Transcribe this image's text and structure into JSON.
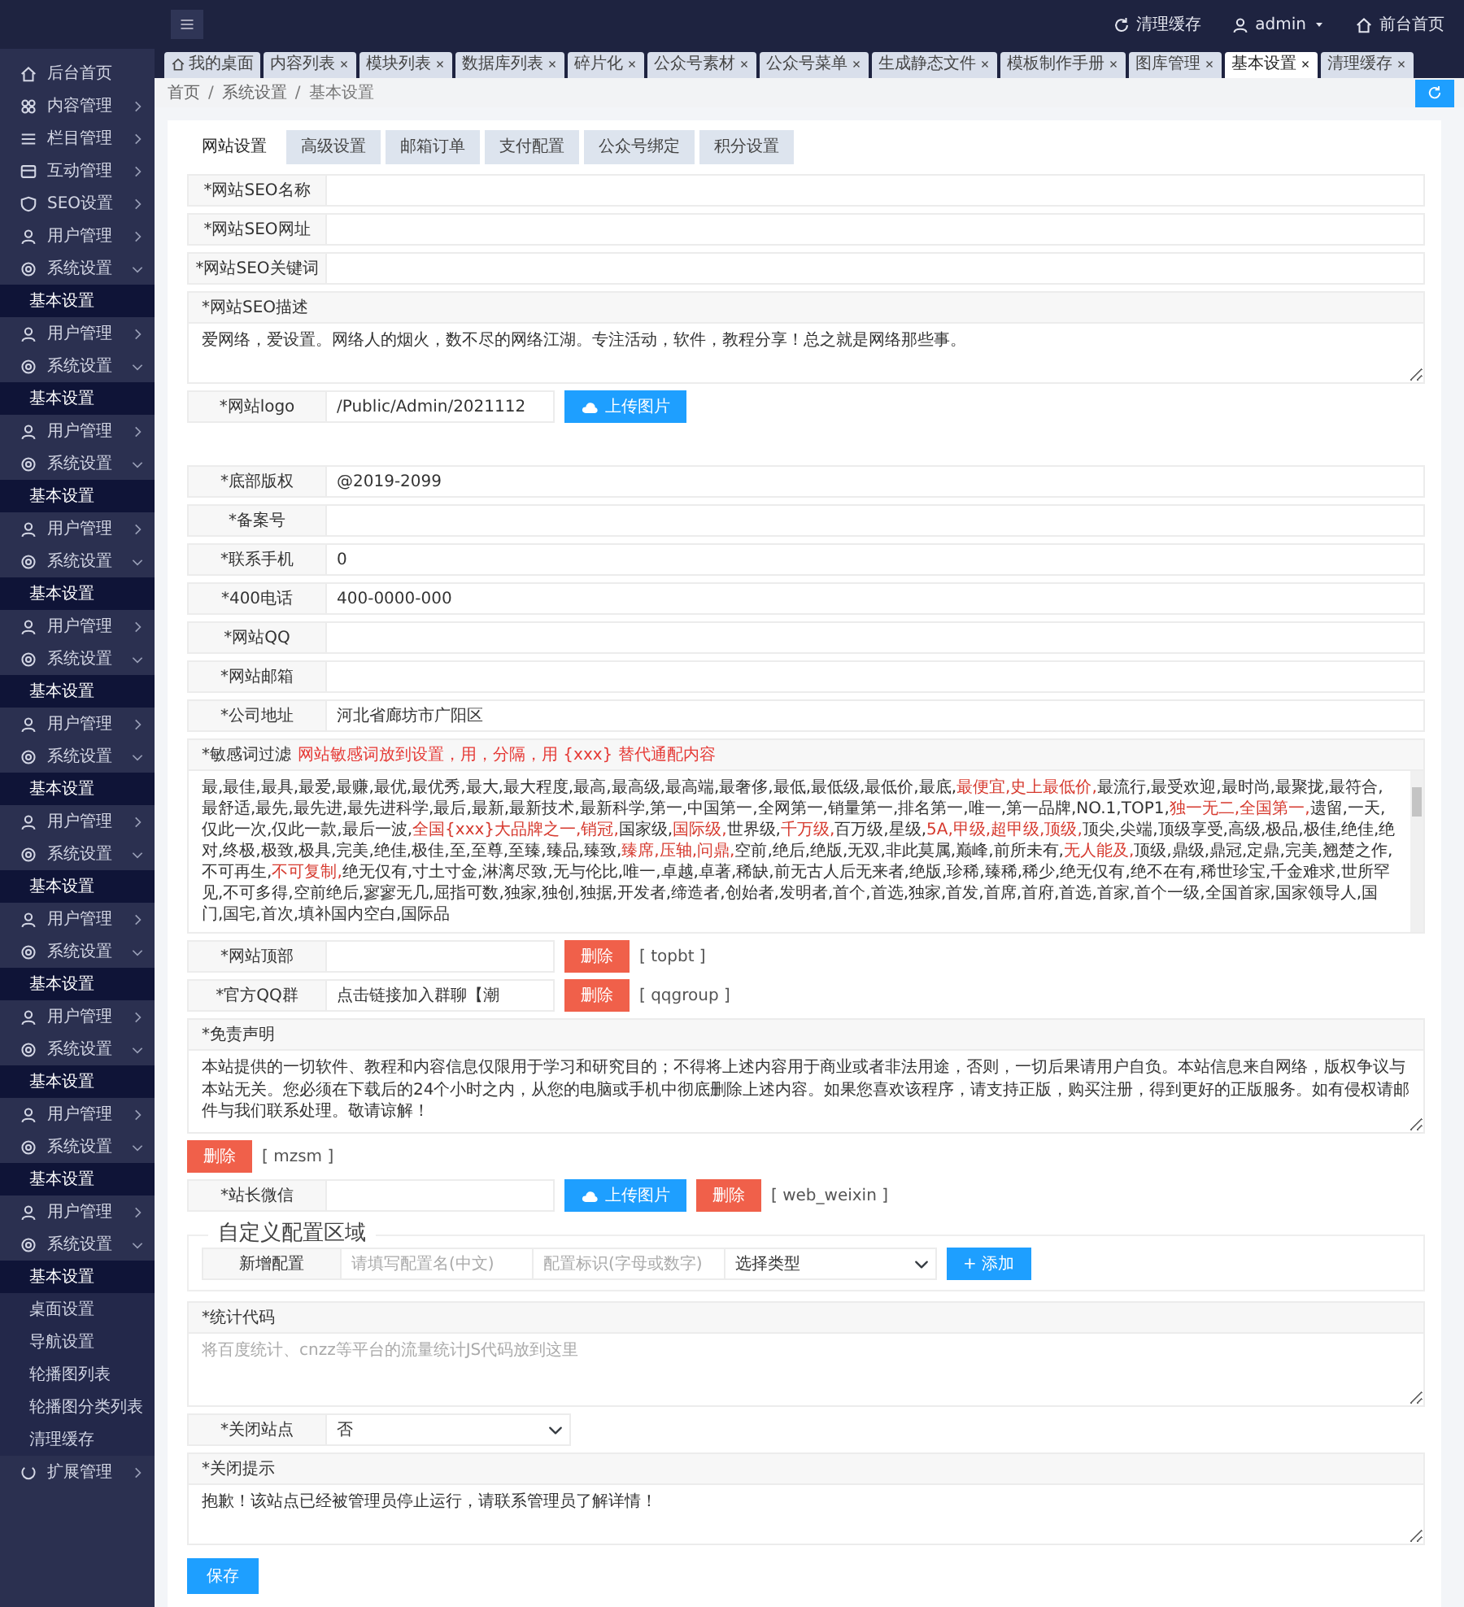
{
  "topbar": {
    "actions": [
      {
        "label": "清理缓存",
        "dropdown": false
      },
      {
        "label": "admin",
        "dropdown": true
      },
      {
        "label": "前台首页",
        "dropdown": false
      }
    ]
  },
  "sidebar": {
    "items": [
      {
        "label": "后台首页"
      },
      {
        "label": "内容管理",
        "expanded": false
      },
      {
        "label": "栏目管理",
        "expanded": false
      },
      {
        "label": "互动管理",
        "expanded": false
      },
      {
        "label": "SEO设置",
        "expanded": false
      },
      {
        "label": "用户管理",
        "expanded": false
      },
      {
        "label": "系统设置",
        "expanded": true,
        "children": [
          {
            "label": "基本设置",
            "selected": true
          }
        ]
      },
      {
        "label": "用户管理",
        "expanded": false
      },
      {
        "label": "系统设置",
        "expanded": true,
        "children": [
          {
            "label": "基本设置",
            "selected": true
          }
        ]
      },
      {
        "label": "用户管理",
        "expanded": false
      },
      {
        "label": "系统设置",
        "expanded": true,
        "children": [
          {
            "label": "基本设置",
            "selected": true
          }
        ]
      },
      {
        "label": "用户管理",
        "expanded": false
      },
      {
        "label": "系统设置",
        "expanded": true,
        "children": [
          {
            "label": "基本设置",
            "selected": true
          }
        ]
      },
      {
        "label": "用户管理",
        "expanded": false
      },
      {
        "label": "系统设置",
        "expanded": true,
        "children": [
          {
            "label": "基本设置",
            "selected": true
          }
        ]
      },
      {
        "label": "用户管理",
        "expanded": false
      },
      {
        "label": "系统设置",
        "expanded": true,
        "children": [
          {
            "label": "基本设置",
            "selected": true
          }
        ]
      },
      {
        "label": "用户管理",
        "expanded": false
      },
      {
        "label": "系统设置",
        "expanded": true,
        "children": [
          {
            "label": "基本设置",
            "selected": true
          }
        ]
      },
      {
        "label": "用户管理",
        "expanded": false
      },
      {
        "label": "系统设置",
        "expanded": true,
        "children": [
          {
            "label": "基本设置",
            "selected": true
          }
        ]
      },
      {
        "label": "用户管理",
        "expanded": false
      },
      {
        "label": "系统设置",
        "expanded": true,
        "children": [
          {
            "label": "基本设置",
            "selected": true
          }
        ]
      },
      {
        "label": "用户管理",
        "expanded": false
      },
      {
        "label": "系统设置",
        "expanded": true,
        "children": [
          {
            "label": "基本设置",
            "selected": true
          }
        ]
      },
      {
        "label": "用户管理",
        "expanded": false
      },
      {
        "label": "系统设置",
        "expanded": true,
        "children": [
          {
            "label": "基本设置",
            "selected": true
          },
          {
            "label": "桌面设置",
            "selected": false
          },
          {
            "label": "导航设置",
            "selected": false
          },
          {
            "label": "轮播图列表",
            "selected": false
          },
          {
            "label": "轮播图分类列表",
            "selected": false
          },
          {
            "label": "清理缓存",
            "selected": false
          }
        ]
      },
      {
        "label": "扩展管理",
        "expanded": false
      }
    ]
  },
  "tabs": [
    {
      "label": "我的桌面",
      "closable": false,
      "selected": false
    },
    {
      "label": "内容列表",
      "closable": true,
      "selected": false
    },
    {
      "label": "模块列表",
      "closable": true,
      "selected": false
    },
    {
      "label": "数据库列表",
      "closable": true,
      "selected": false
    },
    {
      "label": "碎片化",
      "closable": true,
      "selected": false
    },
    {
      "label": "公众号素材",
      "closable": true,
      "selected": false
    },
    {
      "label": "公众号菜单",
      "closable": true,
      "selected": false
    },
    {
      "label": "生成静态文件",
      "closable": true,
      "selected": false
    },
    {
      "label": "模板制作手册",
      "closable": true,
      "selected": false
    },
    {
      "label": "图库管理",
      "closable": true,
      "selected": false
    },
    {
      "label": "基本设置",
      "closable": true,
      "selected": true
    },
    {
      "label": "清理缓存",
      "closable": true,
      "selected": false
    }
  ],
  "breadcrumb": [
    {
      "kind": "link",
      "text": "首页"
    },
    {
      "kind": "separator",
      "text": "/"
    },
    {
      "kind": "link",
      "text": "系统设置"
    },
    {
      "kind": "separator",
      "text": "/"
    },
    {
      "kind": "current",
      "text": "基本设置"
    }
  ],
  "form": {
    "tabs": [
      {
        "label": "网站设置",
        "selected": true
      },
      {
        "label": "高级设置",
        "selected": false
      },
      {
        "label": "邮箱订单",
        "selected": false
      },
      {
        "label": "支付配置",
        "selected": false
      },
      {
        "label": "公众号绑定",
        "selected": false
      },
      {
        "label": "积分设置",
        "selected": false
      }
    ],
    "fields": [
      {
        "kind": "input",
        "label": "*网站SEO名称"
      },
      {
        "kind": "input",
        "label": "*网站SEO网址"
      },
      {
        "kind": "input",
        "label": "*网站SEO关键词"
      },
      {
        "kind": "textarea",
        "label": "*网站SEO描述",
        "value": "爱网络，爱设置。网络人的烟火，数不尽的网络江湖。专注活动，软件，教程分享！总之就是网络那些事。"
      },
      {
        "kind": "upload",
        "label": "*网站logo",
        "value": "/Public/Admin/2021112",
        "button": "上传图片"
      },
      {
        "kind": "input",
        "label": "*底部版权",
        "value": "@2019-2099"
      },
      {
        "kind": "input",
        "label": "*备案号"
      },
      {
        "kind": "input",
        "label": "*联系手机",
        "value": "0"
      },
      {
        "kind": "input",
        "label": "*400电话",
        "value": "400-0000-000"
      },
      {
        "kind": "input",
        "label": "*网站QQ"
      },
      {
        "kind": "input",
        "label": "*网站邮箱"
      },
      {
        "kind": "input",
        "label": "*公司地址",
        "value": "河北省廊坊市广阳区"
      },
      {
        "kind": "wordlist",
        "label": "*敏感词过滤",
        "hint": "网站敏感词放到设置，用，分隔，用 {xxx} 替代通配内容",
        "segments": [
          {
            "text": "最,最佳,最具,最爱,最赚,最优,最优秀,最大,最大程度,最高,最高级,最高端,最奢侈,最低,最低级,最低价,最底,",
            "flagged": false
          },
          {
            "text": "最便宜,史上最低价,",
            "flagged": true
          },
          {
            "text": "最流行,最受欢迎,最时尚,最聚拢,最符合,最舒适,最先,最先进,最先进科学,最后,最新,最新技术,最新科学,第一,中国第一,全网第一,销量第一,排名第一,唯一,第一品牌,NO.1,TOP1,",
            "flagged": false
          },
          {
            "text": "独一无二,全国第一,",
            "flagged": true
          },
          {
            "text": "遗留,一天,仅此一次,仅此一款,最后一波,",
            "flagged": false
          },
          {
            "text": "全国{xxx}大品牌之一,销冠,",
            "flagged": true
          },
          {
            "text": "国家级,",
            "flagged": false
          },
          {
            "text": "国际级,",
            "flagged": true
          },
          {
            "text": "世界级,",
            "flagged": false
          },
          {
            "text": "千万级,",
            "flagged": true
          },
          {
            "text": "百万级,星级,",
            "flagged": false
          },
          {
            "text": "5A,甲级,超甲级,顶级,",
            "flagged": true
          },
          {
            "text": "顶尖,尖端,顶级享受,高级,极品,极佳,绝佳,绝对,终极,极致,极具,完美,绝佳,极佳,至,至尊,至臻,臻品,臻致,",
            "flagged": false
          },
          {
            "text": "臻席,压轴,问鼎,",
            "flagged": true
          },
          {
            "text": "空前,绝后,绝版,无双,非此莫属,巅峰,前所未有,",
            "flagged": false
          },
          {
            "text": "无人能及,",
            "flagged": true
          },
          {
            "text": "顶级,鼎级,鼎冠,定鼎,完美,翘楚之作,不可再生,",
            "flagged": false
          },
          {
            "text": "不可复制,",
            "flagged": true
          },
          {
            "text": "绝无仅有,寸土寸金,淋漓尽致,无与伦比,唯一,卓越,卓著,稀缺,前无古人后无来者,绝版,珍稀,臻稀,稀少,绝无仅有,绝不在有,稀世珍宝,千金难求,世所罕见,不可多得,空前绝后,寥寥无几,屈指可数,独家,独创,独据,开发者,缔造者,创始者,发明者,首个,首选,独家,首发,首席,首府,首选,首家,首个一级,全国首家,国家领导人,国门,国宅,首次,填补国内空白,国际品",
            "flagged": false
          }
        ]
      },
      {
        "kind": "input",
        "label": "*网站顶部",
        "delete": "删除",
        "key": "[ topbt ]"
      },
      {
        "kind": "input",
        "label": "*官方QQ群",
        "value": "点击链接加入群聊【潮",
        "delete": "删除",
        "key": "[ qqgroup ]"
      },
      {
        "kind": "textarea",
        "label": "*免责声明",
        "value": "本站提供的一切软件、教程和内容信息仅限用于学习和研究目的；不得将上述内容用于商业或者非法用途，否则，一切后果请用户自负。本站信息来自网络，版权争议与本站无关。您必须在下载后的24个小时之内，从您的电脑或手机中彻底删除上述内容。如果您喜欢该程序，请支持正版，购买注册，得到更好的正版服务。如有侵权请邮件与我们联系处理。敬请谅解！",
        "delete": "删除",
        "key": "[ mzsm ]"
      },
      {
        "kind": "upload",
        "label": "*站长微信",
        "button": "上传图片",
        "delete": "删除",
        "key": "[ web_weixin ]"
      },
      {
        "kind": "config",
        "legend": "自定义配置区域",
        "label": "新增配置",
        "name_placeholder": "请填写配置名(中文)",
        "key_placeholder": "配置标识(字母或数字)",
        "type_value": "选择类型",
        "button": "+ 添加"
      },
      {
        "kind": "textarea",
        "label": "*统计代码",
        "placeholder": "将百度统计、cnzz等平台的流量统计JS代码放到这里"
      },
      {
        "kind": "select",
        "label": "*关闭站点",
        "value": "否"
      },
      {
        "kind": "textarea",
        "label": "*关闭提示",
        "value": "抱歉！该站点已经被管理员停止运行，请联系管理员了解详情！"
      }
    ],
    "save": "保存"
  }
}
